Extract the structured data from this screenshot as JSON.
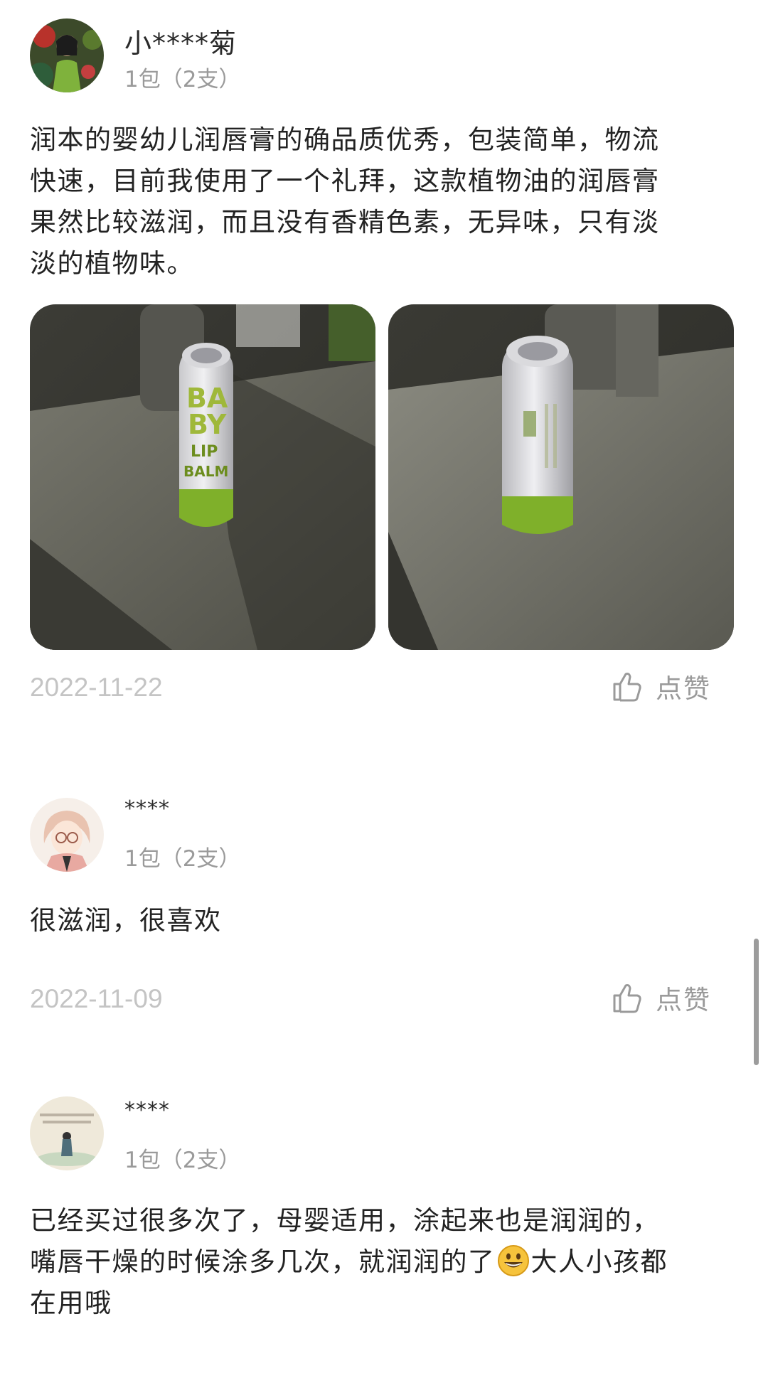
{
  "reviews": [
    {
      "user": "小****菊",
      "spec": "1包（2支）",
      "text_lines": [
        "润本的婴幼儿润唇膏的确品质优秀，包装简单，物流",
        "快速，目前我使用了一个礼拜，这款植物油的润唇膏",
        "果然比较滋润，而且没有香精色素，无异味，只有淡",
        "淡的植物味。"
      ],
      "photo_texts": {
        "front": [
          "BA",
          "BY",
          "LIP",
          "BALM"
        ]
      },
      "date": "2022-11-22",
      "like_label": "点赞",
      "like_icon": "thumbs-up-icon"
    },
    {
      "user": "****",
      "spec": "1包（2支）",
      "text_lines": [
        "很滋润，很喜欢"
      ],
      "date": "2022-11-09",
      "like_label": "点赞",
      "like_icon": "thumbs-up-icon"
    },
    {
      "user": "****",
      "spec": "1包（2支）",
      "text_lines": [
        "已经买过很多次了，母婴适用，涂起来也是润润的，",
        "嘴唇干燥的时候涂多几次，就润润的了",
        "大人小孩都",
        "在用哦"
      ],
      "emoji": "grinning-face-emoji"
    }
  ],
  "colors": {
    "text": "#222222",
    "muted": "#9a9a9a",
    "date": "#c4c4c4",
    "balm_green": "#7fb02a"
  }
}
